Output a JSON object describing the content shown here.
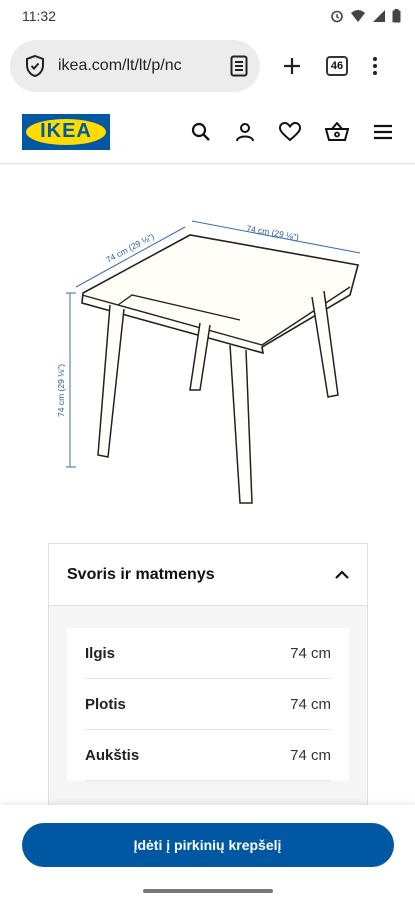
{
  "status": {
    "time": "11:32"
  },
  "browser": {
    "url": "ikea.com/lt/lt/p/nc",
    "tab_count": "46"
  },
  "site": {
    "logo_text": "IKEA"
  },
  "diagram": {
    "top_width_label": "74 cm (29 ⅛\")",
    "top_depth_label": "74 cm (29 ⅛\")",
    "height_label": "74 cm (29 ⅛\")"
  },
  "dimensions": {
    "title": "Svoris ir matmenys",
    "rows": [
      {
        "label": "Ilgis",
        "value": "74 cm"
      },
      {
        "label": "Plotis",
        "value": "74 cm"
      },
      {
        "label": "Aukštis",
        "value": "74 cm"
      }
    ]
  },
  "cta": {
    "label": "Įdėti į pirkinių krepšelį"
  },
  "colors": {
    "brand_blue": "#0058a3",
    "brand_yellow": "#ffdb00"
  }
}
